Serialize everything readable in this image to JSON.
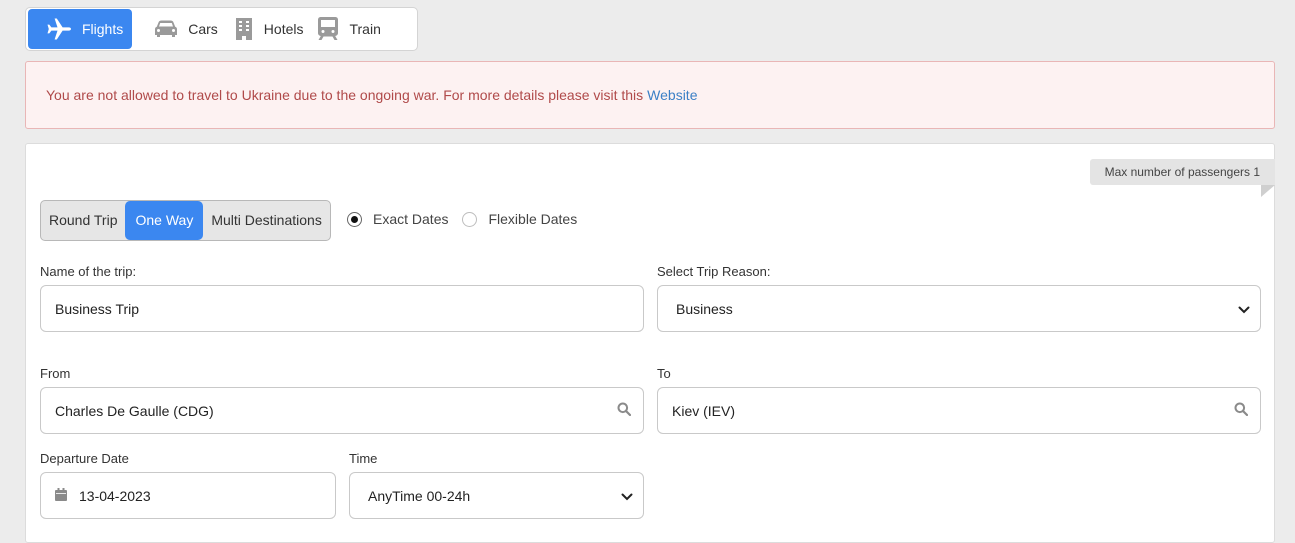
{
  "tabs": [
    {
      "label": "Flights",
      "icon": "airplane-icon",
      "active": true
    },
    {
      "label": "Cars",
      "icon": "car-icon",
      "active": false
    },
    {
      "label": "Hotels",
      "icon": "building-icon",
      "active": false
    },
    {
      "label": "Train",
      "icon": "train-icon",
      "active": false
    }
  ],
  "alert": {
    "message": "You are not allowed to travel to Ukraine due to the ongoing war. For more details please visit this",
    "link_text": "Website"
  },
  "card": {
    "max_passengers": "Max number of passengers 1",
    "trip_types": [
      "Round Trip",
      "One Way",
      "Multi Destinations"
    ],
    "trip_type_selected": "One Way",
    "date_modes": [
      "Exact Dates",
      "Flexible Dates"
    ],
    "date_mode_selected": "Exact Dates",
    "trip_name": {
      "label": "Name of the trip:",
      "value": "Business Trip"
    },
    "trip_reason": {
      "label": "Select Trip Reason:",
      "value": "Business"
    },
    "from": {
      "label": "From",
      "value": "Charles De Gaulle (CDG)"
    },
    "to": {
      "label": "To",
      "value": "Kiev (IEV)"
    },
    "departure_date": {
      "label": "Departure Date",
      "value": "13-04-2023"
    },
    "time": {
      "label": "Time",
      "value": "AnyTime 00-24h"
    }
  },
  "colors": {
    "accent": "#3b87f0",
    "alert_bg": "#fdf2f2",
    "alert_text": "#b04a4a",
    "link": "#3c80c6"
  }
}
